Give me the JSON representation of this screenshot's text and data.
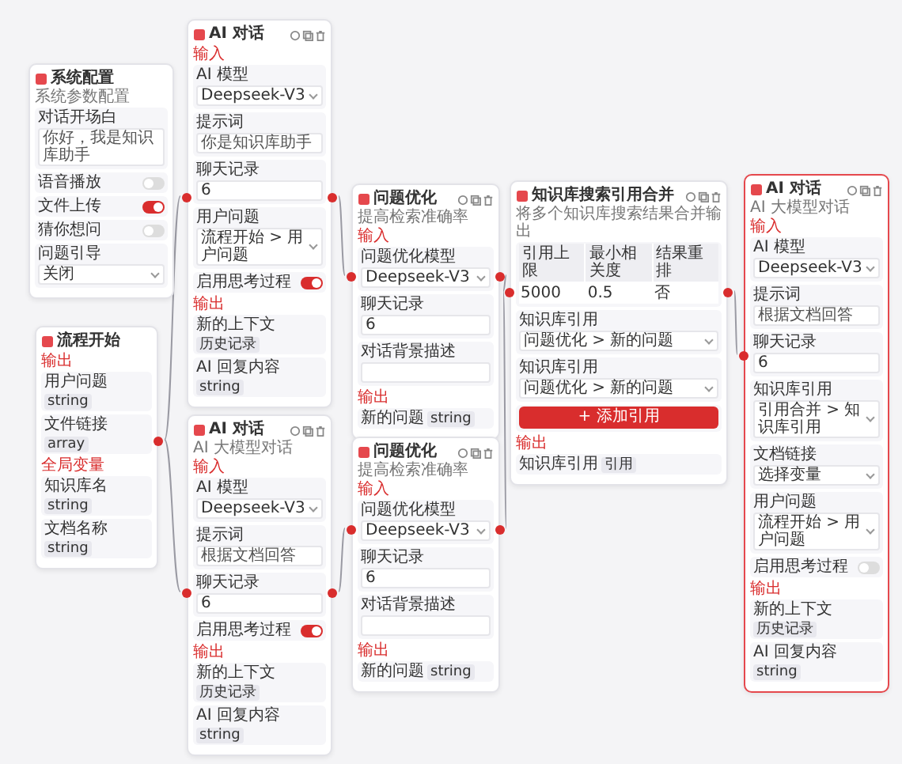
{
  "nodes": [
    {
      "kind": "config",
      "title": "系统配置",
      "intro": "系统参数配置",
      "fields": [
        {
          "kind": "textarea",
          "label": "对话开场白",
          "value": "你好，我是知识库助手"
        },
        {
          "kind": "toggle",
          "label": "语音播放",
          "on": false
        },
        {
          "kind": "toggle",
          "label": "文件上传",
          "on": true
        },
        {
          "kind": "toggle",
          "label": "猜你想问",
          "on": false
        },
        {
          "kind": "select",
          "label": "问题引导",
          "value": "关闭"
        }
      ]
    },
    {
      "kind": "start",
      "title": "流程开始",
      "fields": [
        {
          "kind": "section",
          "label": "输出"
        },
        {
          "kind": "tag",
          "label": "用户问题",
          "tag": "string"
        },
        {
          "kind": "tag",
          "label": "文件链接",
          "tag": "array"
        },
        {
          "kind": "section",
          "label": "全局变量"
        },
        {
          "kind": "tag",
          "label": "知识库名",
          "tag": "string"
        },
        {
          "kind": "tag",
          "label": "文档名称",
          "tag": "string"
        }
      ]
    },
    {
      "kind": "ai",
      "title": "AI 对话",
      "fields": [
        {
          "kind": "section",
          "label": "输入"
        },
        {
          "kind": "select",
          "label": "AI 模型",
          "value": "Deepseek-V3"
        },
        {
          "kind": "textarea",
          "label": "提示词",
          "value": "你是知识库助手"
        },
        {
          "kind": "input",
          "label": "聊天记录",
          "value": "6"
        },
        {
          "kind": "select",
          "label": "用户问题",
          "value": "流程开始 > 用户问题"
        },
        {
          "kind": "toggle",
          "label": "启用思考过程",
          "on": true
        },
        {
          "kind": "section",
          "label": "输出"
        },
        {
          "kind": "tag",
          "label": "新的上下文",
          "tag": "历史记录"
        },
        {
          "kind": "tag",
          "label": "AI 回复内容",
          "tag": "string"
        }
      ]
    },
    {
      "kind": "ai",
      "title": "AI 对话",
      "intro": "AI 大模型对话",
      "fields": [
        {
          "kind": "section",
          "label": "输入"
        },
        {
          "kind": "select",
          "label": "AI 模型",
          "value": "Deepseek-V3"
        },
        {
          "kind": "textarea",
          "label": "提示词",
          "value": "根据文档回答"
        },
        {
          "kind": "input",
          "label": "聊天记录",
          "value": "6"
        },
        {
          "kind": "toggle",
          "label": "启用思考过程",
          "on": true
        },
        {
          "kind": "section",
          "label": "输出"
        },
        {
          "kind": "tag",
          "label": "新的上下文",
          "tag": "历史记录"
        },
        {
          "kind": "tag",
          "label": "AI 回复内容",
          "tag": "string"
        }
      ]
    },
    {
      "kind": "search",
      "title": "问题优化",
      "intro": "提高检索准确率",
      "fields": [
        {
          "kind": "section",
          "label": "输入"
        },
        {
          "kind": "select",
          "label": "问题优化模型",
          "value": "Deepseek-V3"
        },
        {
          "kind": "input",
          "label": "聊天记录",
          "value": "6"
        },
        {
          "kind": "input",
          "label": "对话背景描述"
        },
        {
          "kind": "section",
          "label": "输出"
        },
        {
          "kind": "tag",
          "label": "新的问题",
          "tag": "string"
        }
      ]
    },
    {
      "kind": "search",
      "title": "问题优化",
      "intro": "提高检索准确率",
      "fields": [
        {
          "kind": "section",
          "label": "输入"
        },
        {
          "kind": "select",
          "label": "问题优化模型",
          "value": "Deepseek-V3"
        },
        {
          "kind": "input",
          "label": "聊天记录",
          "value": "6"
        },
        {
          "kind": "input",
          "label": "对话背景描述"
        },
        {
          "kind": "section",
          "label": "输出"
        },
        {
          "kind": "tag",
          "label": "新的问题",
          "tag": "string"
        }
      ]
    },
    {
      "kind": "merge",
      "title": "知识库搜索引用合并",
      "intro": "将多个知识库搜索结果合并输出",
      "fields": [
        {
          "kind": "table",
          "columns": [
            "引用上限",
            "最小相关度",
            "结果重排"
          ],
          "rows": [
            [
              "5000",
              "0.5",
              "否"
            ]
          ]
        },
        {
          "kind": "select",
          "label": "知识库引用",
          "value": "问题优化 > 新的问题"
        },
        {
          "kind": "select",
          "label": "知识库引用",
          "value": "问题优化 > 新的问题"
        },
        {
          "kind": "button",
          "label": "+ 添加引用"
        },
        {
          "kind": "section",
          "label": "输出"
        },
        {
          "kind": "tag",
          "label": "知识库引用",
          "tag": "引用"
        }
      ]
    },
    {
      "kind": "ai",
      "title": "AI 对话",
      "intro": "AI 大模型对话",
      "fields": [
        {
          "kind": "section",
          "label": "输入"
        },
        {
          "kind": "select",
          "label": "AI 模型",
          "value": "Deepseek-V3"
        },
        {
          "kind": "textarea",
          "label": "提示词",
          "value": "根据文档回答"
        },
        {
          "kind": "input",
          "label": "聊天记录",
          "value": "6"
        },
        {
          "kind": "select",
          "label": "知识库引用",
          "value": "引用合并 > 知识库引用"
        },
        {
          "kind": "select",
          "label": "文档链接",
          "value": "选择变量"
        },
        {
          "kind": "select",
          "label": "用户问题",
          "value": "流程开始 > 用户问题"
        },
        {
          "kind": "toggle",
          "label": "启用思考过程",
          "on": false
        },
        {
          "kind": "section",
          "label": "输出"
        },
        {
          "kind": "tag",
          "label": "新的上下文",
          "tag": "历史记录"
        },
        {
          "kind": "tag",
          "label": "AI 回复内容",
          "tag": "string"
        }
      ]
    }
  ]
}
